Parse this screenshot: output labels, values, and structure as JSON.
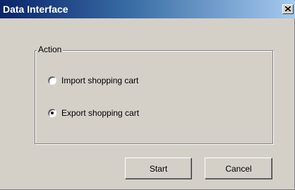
{
  "window": {
    "title": "Data Interface",
    "close_glyph": "×",
    "accent": "#0a246a",
    "face_color": "#d4d0c8"
  },
  "action_group": {
    "label": "Action",
    "options": [
      {
        "label": "Import shopping cart",
        "selected": false
      },
      {
        "label": "Export shopping cart",
        "selected": true
      }
    ]
  },
  "buttons": {
    "start_label": "Start",
    "cancel_label": "Cancel"
  }
}
